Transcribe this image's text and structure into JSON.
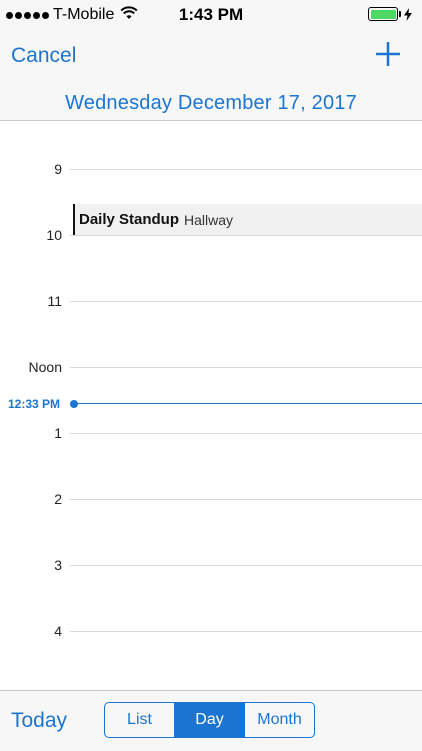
{
  "status_bar": {
    "carrier": "T-Mobile",
    "time": "1:43 PM",
    "battery_level": 1.0,
    "icons": [
      "signal-dots-icon",
      "wifi-icon",
      "battery-icon",
      "charging-bolt-icon"
    ]
  },
  "nav": {
    "cancel_label": "Cancel",
    "add_icon": "plus-icon",
    "date_title": "Wednesday December 17, 2017"
  },
  "day_view": {
    "hours": [
      "9",
      "10",
      "11",
      "Noon",
      "1",
      "2",
      "3",
      "4"
    ],
    "current_time": "12:33 PM",
    "events": [
      {
        "title": "Daily Standup",
        "location": "Hallway"
      }
    ]
  },
  "tab_bar": {
    "today_label": "Today",
    "segments": [
      "List",
      "Day",
      "Month"
    ],
    "selected_segment": "Day"
  },
  "colors": {
    "accent": "#1a75d2",
    "bar_background": "#f7f7f7",
    "battery_fill": "#4cd964",
    "event_background": "#f0f0f0"
  }
}
